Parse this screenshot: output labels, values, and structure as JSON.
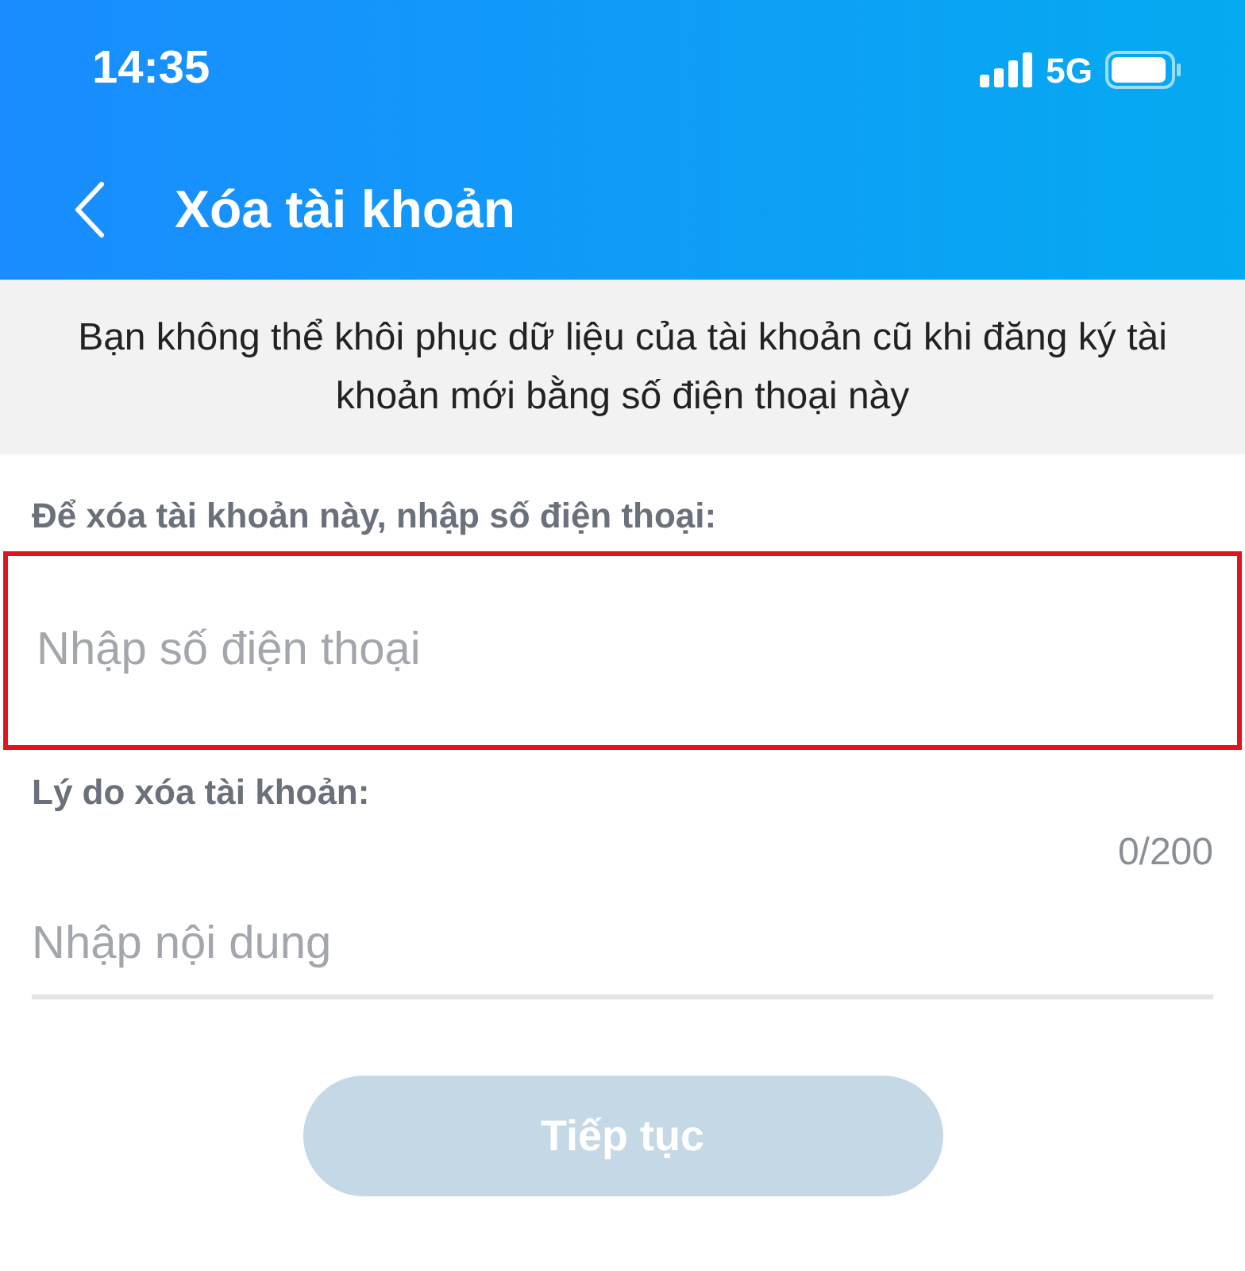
{
  "status_bar": {
    "time": "14:35",
    "network": "5G"
  },
  "header": {
    "title": "Xóa tài khoản"
  },
  "notice": "Bạn không thể khôi phục dữ liệu của tài khoản cũ khi đăng ký tài khoản mới bằng số điện thoại này",
  "phone": {
    "label": "Để xóa tài khoản này, nhập số điện thoại:",
    "placeholder": "Nhập số điện thoại",
    "highlighted": true
  },
  "reason": {
    "label": "Lý do xóa tài khoản:",
    "counter": "0/200",
    "placeholder": "Nhập nội dung"
  },
  "continue_button": {
    "label": "Tiếp tục",
    "disabled": true
  }
}
